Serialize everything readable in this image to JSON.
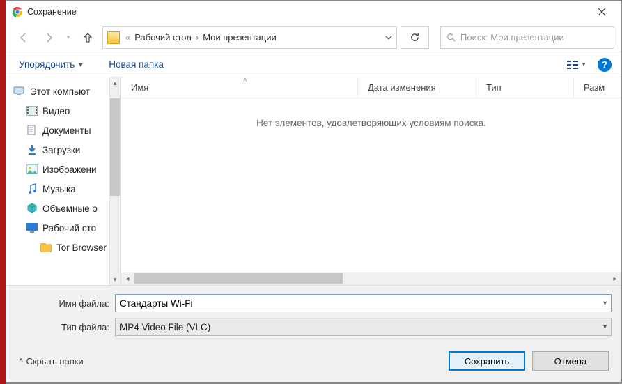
{
  "window": {
    "title": "Сохранение"
  },
  "nav": {
    "crumb1": "Рабочий стол",
    "crumb2": "Мои презентации",
    "searchPlaceholder": "Поиск: Мои презентации"
  },
  "toolbar": {
    "organize": "Упорядочить",
    "newFolder": "Новая папка"
  },
  "tree": {
    "thisPC": "Этот компьют",
    "video": "Видео",
    "documents": "Документы",
    "downloads": "Загрузки",
    "pictures": "Изображени",
    "music": "Музыка",
    "volumes": "Объемные о",
    "desktop": "Рабочий сто",
    "tor": "Tor Browser"
  },
  "columns": {
    "name": "Имя",
    "date": "Дата изменения",
    "type": "Тип",
    "size": "Разм"
  },
  "list": {
    "emptyMessage": "Нет элементов, удовлетворяющих условиям поиска."
  },
  "form": {
    "fileNameLabel": "Имя файла:",
    "fileNameValue": "Стандарты Wi-Fi",
    "fileTypeLabel": "Тип файла:",
    "fileTypeValue": "MP4 Video File (VLC)"
  },
  "buttons": {
    "hideFolders": "Скрыть папки",
    "save": "Сохранить",
    "cancel": "Отмена"
  }
}
